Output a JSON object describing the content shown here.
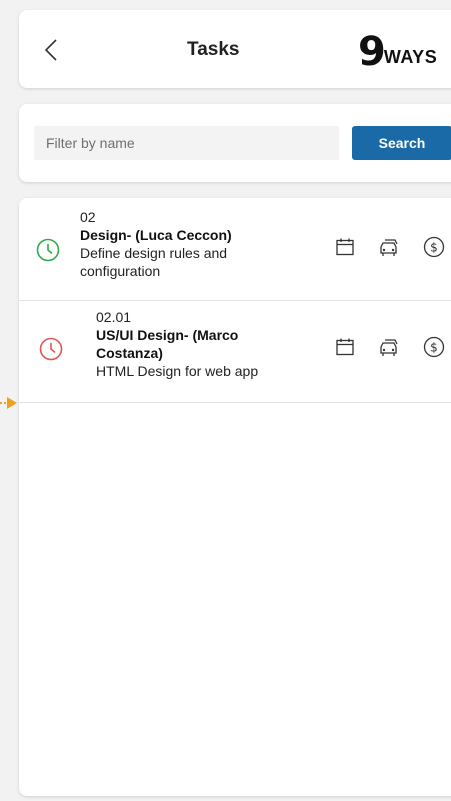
{
  "header": {
    "title": "Tasks",
    "logo_number": "9",
    "logo_text": "WAYS"
  },
  "filter": {
    "placeholder": "Filter by name",
    "value": "",
    "search_label": "Search"
  },
  "tasks": [
    {
      "code": "02",
      "name": "Design- (Luca Ceccon)",
      "description": "Define design rules and configuration",
      "status": "on-time",
      "status_color": "#2eaa4a"
    },
    {
      "code": "02.01",
      "name": "US/UI Design- (Marco Costanza)",
      "description": "HTML Design for web app",
      "status": "overdue",
      "status_color": "#e05555"
    }
  ],
  "icons": {
    "back": "chevron-left-icon",
    "calendar": "calendar-icon",
    "travel": "car-icon",
    "expense": "dollar-icon",
    "status": "clock-icon",
    "pointer": "arrow-right-icon"
  },
  "colors": {
    "accent": "#1a6aa8",
    "pointer": "#f0a020"
  }
}
